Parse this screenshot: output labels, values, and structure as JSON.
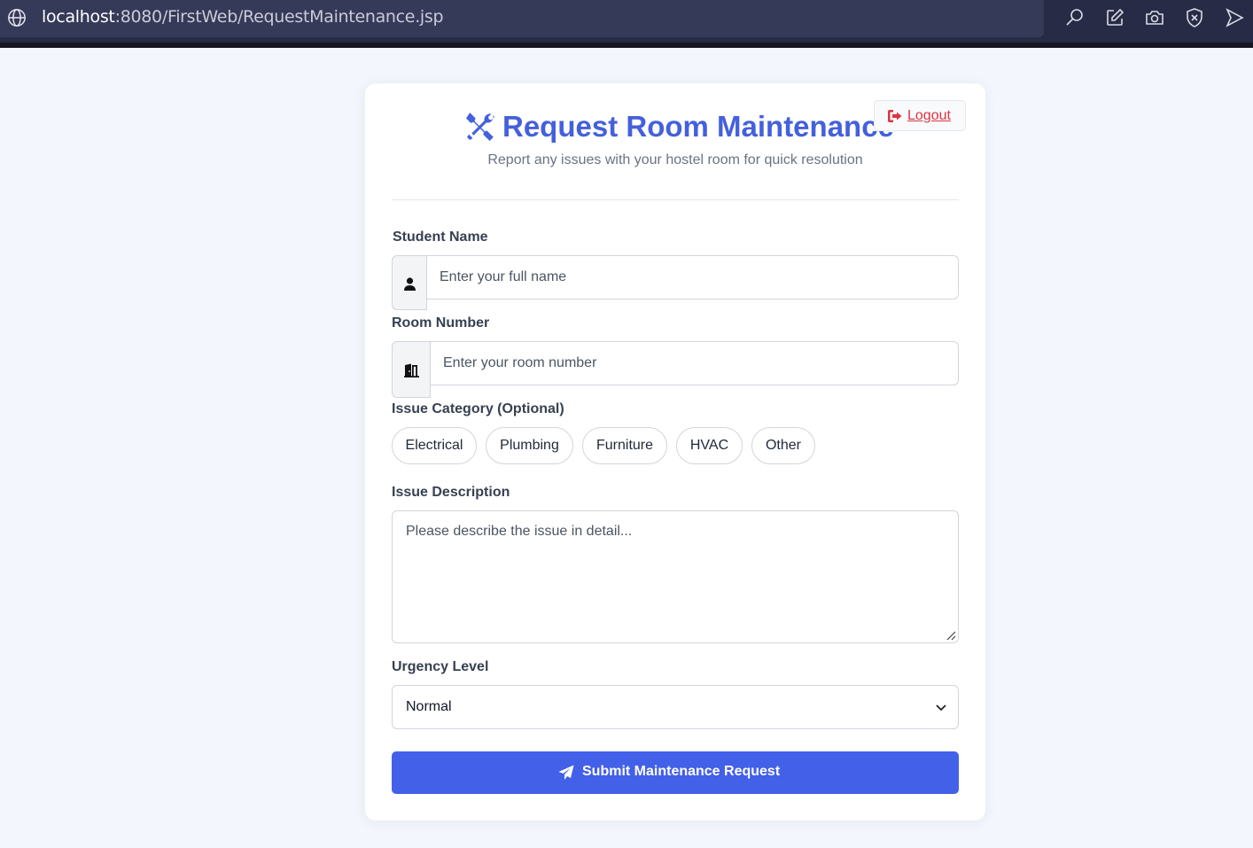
{
  "browser": {
    "url_host": "localhost",
    "url_rest": ":8080/FirstWeb/RequestMaintenance.jsp",
    "toolbar_icons": [
      "search-icon",
      "edit-icon",
      "camera-icon",
      "shield-icon",
      "send-icon"
    ]
  },
  "header": {
    "title": "Request Room Maintenance",
    "subtitle": "Report any issues with your hostel room for quick resolution",
    "logout_label": "Logout"
  },
  "form": {
    "student_name": {
      "label": "Student Name",
      "placeholder": "Enter your full name",
      "value": ""
    },
    "room_number": {
      "label": "Room Number",
      "placeholder": "Enter your room number",
      "value": ""
    },
    "issue_category": {
      "label": "Issue Category (Optional)",
      "options": [
        "Electrical",
        "Plumbing",
        "Furniture",
        "HVAC",
        "Other"
      ]
    },
    "issue_description": {
      "label": "Issue Description",
      "placeholder": "Please describe the issue in detail...",
      "value": ""
    },
    "urgency": {
      "label": "Urgency Level",
      "selected": "Normal"
    },
    "submit_label": "Submit Maintenance Request"
  },
  "colors": {
    "accent": "#4460dc",
    "button": "#4360e8",
    "logout": "#dc3545",
    "page_background": "#f3f6fc"
  }
}
